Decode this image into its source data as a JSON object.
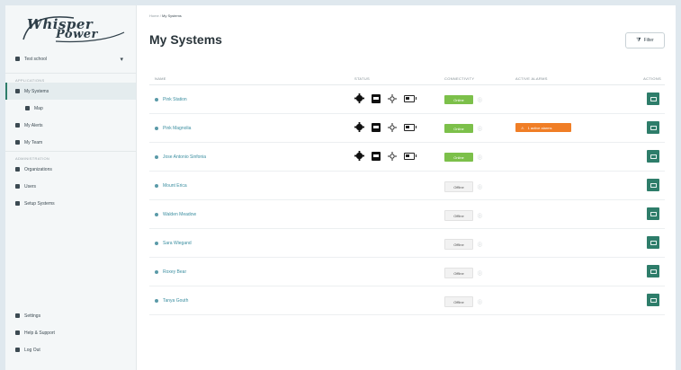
{
  "app": {
    "logo_line1": "Whisper",
    "logo_line2": "Power"
  },
  "sidebar": {
    "org_selector": {
      "label": "Test school"
    },
    "section_1": "Applications",
    "items": [
      {
        "label": "My Systems",
        "icon": "solar-icon",
        "active": true,
        "sub": false
      },
      {
        "label": "Map",
        "icon": "map-icon",
        "active": false,
        "sub": true
      },
      {
        "label": "My Alerts",
        "icon": "bell-icon",
        "active": false,
        "sub": false
      },
      {
        "label": "My Team",
        "icon": "team-icon",
        "active": false,
        "sub": false
      }
    ],
    "section_2": "Administration",
    "admin_items": [
      {
        "label": "Organizations",
        "icon": "building-icon"
      },
      {
        "label": "Users",
        "icon": "user-icon"
      },
      {
        "label": "Setup Systems",
        "icon": "setup-icon"
      }
    ],
    "bottom_items": [
      {
        "label": "Settings",
        "icon": "gear-icon"
      },
      {
        "label": "Help & Support",
        "icon": "help-icon"
      },
      {
        "label": "Log Out",
        "icon": "logout-icon"
      }
    ]
  },
  "header": {
    "breadcrumb_root": "Home",
    "breadcrumb_current": "My Systems",
    "title": "My Systems",
    "filter_label": "Filter"
  },
  "table": {
    "columns": [
      "NAME",
      "STATUS",
      "CONNECTIVITY",
      "ACTIVE ALARMS",
      "ACTIONS"
    ],
    "rows": [
      {
        "name": "Pink Station",
        "has_status": true,
        "connectivity": "Online",
        "alarm": ""
      },
      {
        "name": "Pink Magnolia",
        "has_status": true,
        "connectivity": "Online",
        "alarm": "1 active alarms"
      },
      {
        "name": "Jose Antonio Sinfonia",
        "has_status": true,
        "connectivity": "Online",
        "alarm": ""
      },
      {
        "name": "Mount Erica",
        "has_status": false,
        "connectivity": "Offline",
        "alarm": ""
      },
      {
        "name": "Walden Meadow",
        "has_status": false,
        "connectivity": "Offline",
        "alarm": ""
      },
      {
        "name": "Sara Wiegand",
        "has_status": false,
        "connectivity": "Offline",
        "alarm": ""
      },
      {
        "name": "Roxey Bear",
        "has_status": false,
        "connectivity": "Offline",
        "alarm": ""
      },
      {
        "name": "Tanya Gouth",
        "has_status": false,
        "connectivity": "Offline",
        "alarm": ""
      }
    ]
  },
  "colors": {
    "accent": "#2e7d6a",
    "online": "#7cc04a",
    "alarm": "#f07e26",
    "link": "#3b8ea0"
  }
}
